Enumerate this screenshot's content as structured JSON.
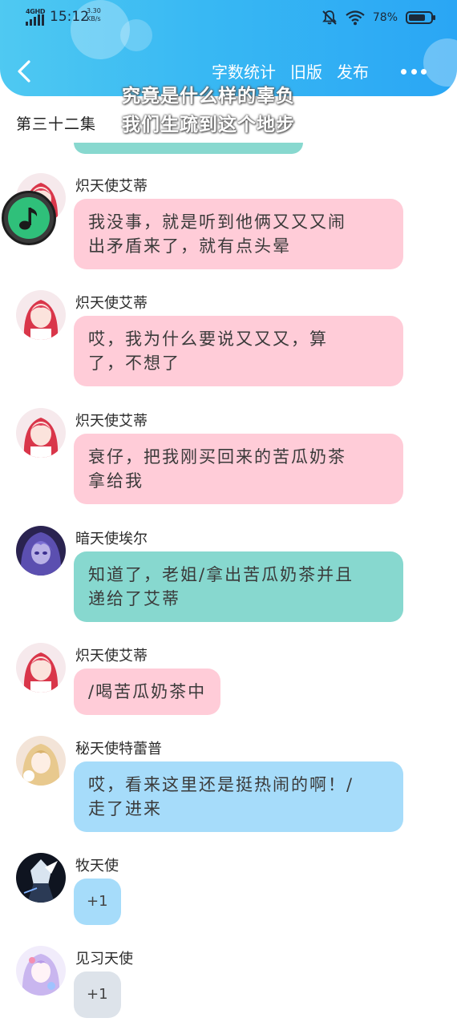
{
  "status_bar": {
    "network_type": "4GHD",
    "time": "15:12",
    "speed_value": "3.30",
    "speed_unit": "KB/s",
    "battery_percent": "78%",
    "battery_level": 0.78
  },
  "header": {
    "actions": [
      "字数统计",
      "旧版",
      "发布"
    ]
  },
  "episode_title": "第三十二集",
  "lyric_overlay": {
    "line1": "究竟是什么样的辜负",
    "line2": "我们生疏到这个地步"
  },
  "messages": [
    {
      "sender": "炽天使艾蒂",
      "line1": "我没事，就是听到他俩又又又闹",
      "line2": "出矛盾来了，就有点头晕"
    },
    {
      "sender": "炽天使艾蒂",
      "line1": "哎，我为什么要说又又又，算",
      "line2": "了，不想了"
    },
    {
      "sender": "炽天使艾蒂",
      "line1": "衰仔，把我刚买回来的苦瓜奶茶",
      "line2": "拿给我"
    },
    {
      "sender": "暗天使埃尔",
      "line1": "知道了，老姐/拿出苦瓜奶茶并且",
      "line2": "递给了艾蒂"
    },
    {
      "sender": "炽天使艾蒂",
      "line1": "/喝苦瓜奶茶中"
    },
    {
      "sender": "秘天使特蕾普",
      "line1": "哎，看来这里还是挺热闹的啊！/",
      "line2": "走了进来"
    },
    {
      "sender": "牧天使",
      "line1": "+1"
    },
    {
      "sender": "见习天使",
      "line1": "+1"
    }
  ],
  "colors": {
    "header_gradient_start": "#4fc9f2",
    "header_gradient_end": "#2aa6f4",
    "bubble_pink": "#ffccd8",
    "bubble_teal": "#87d8cf",
    "bubble_blue": "#a6dcfa",
    "bubble_grey": "#dde3ea"
  },
  "icons": {
    "back": "chevron-left-icon",
    "more": "more-dots-icon",
    "music": "music-note-icon",
    "mute": "bell-off-icon",
    "wifi": "wifi-icon"
  }
}
